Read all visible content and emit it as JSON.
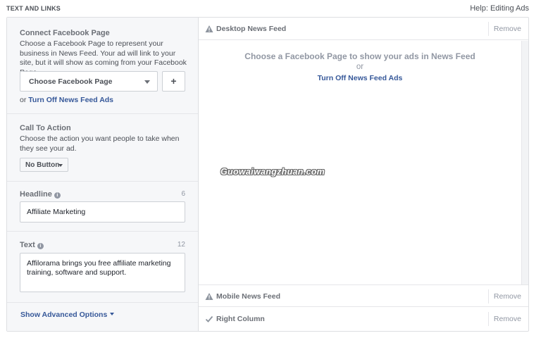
{
  "header": {
    "title": "TEXT AND LINKS",
    "help_link": "Help: Editing Ads"
  },
  "connect_page": {
    "title": "Connect Facebook Page",
    "description": "Choose a Facebook Page to represent your business in News Feed. Your ad will link to your site, but it will show as coming from your Facebook Page.",
    "select_label": "Choose Facebook Page",
    "add_label": "+",
    "or_prefix": "or",
    "turn_off_link": "Turn Off News Feed Ads"
  },
  "call_to_action": {
    "title": "Call To Action",
    "description": "Choose the action you want people to take when they see your ad.",
    "button_label": "No Button"
  },
  "headline": {
    "label": "Headline",
    "info_icon": "i",
    "count": "6",
    "value": "Affiliate Marketing"
  },
  "text_field": {
    "label": "Text",
    "info_icon": "i",
    "count": "12",
    "value": "Affilorama brings you free affiliate marketing training, software and support."
  },
  "advanced": {
    "label": "Show Advanced Options"
  },
  "previews": {
    "desktop": {
      "title": "Desktop News Feed",
      "icon": "warning-icon",
      "remove": "Remove",
      "message": "Choose a Facebook Page to show your ads in News Feed",
      "or": "or",
      "link": "Turn Off News Feed Ads"
    },
    "mobile": {
      "title": "Mobile News Feed",
      "icon": "warning-icon",
      "remove": "Remove"
    },
    "right_column": {
      "title": "Right Column",
      "icon": "check-icon",
      "remove": "Remove"
    }
  },
  "watermark": "Guowaiwangzhuan.com",
  "colors": {
    "link": "#365899",
    "panel_bg": "#f6f7f9",
    "border": "#dddfe2",
    "muted": "#9197a3"
  }
}
